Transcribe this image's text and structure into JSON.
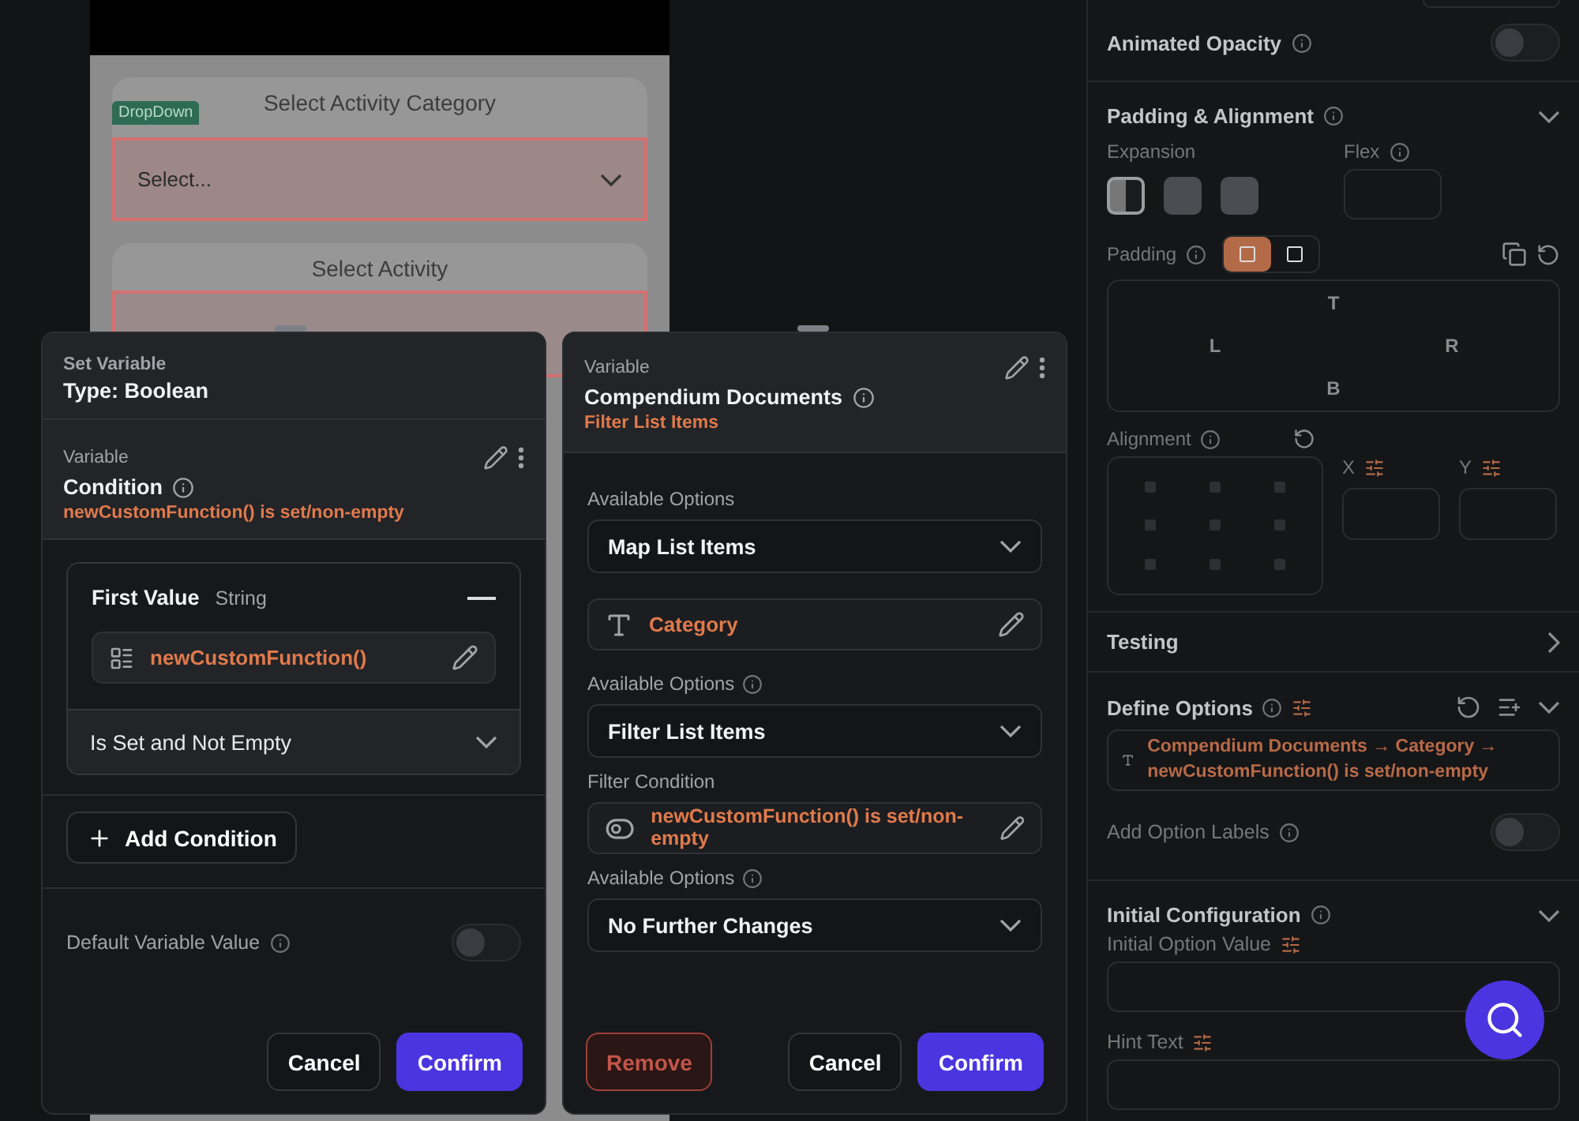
{
  "preview": {
    "cards": [
      {
        "title": "Select Activity Category",
        "tag": "DropDown",
        "value": "Select..."
      },
      {
        "title": "Select Activity"
      }
    ]
  },
  "set_variable_dialog": {
    "heading": "Set Variable",
    "type": "Type: Boolean",
    "variable_label": "Variable",
    "variable_name": "Condition",
    "variable_value": "newCustomFunction() is set/non-empty",
    "condition": {
      "label": "First Value",
      "value_type": "String",
      "function": "newCustomFunction()",
      "operator": "Is Set and Not Empty"
    },
    "add_condition": "Add Condition",
    "default_label": "Default Variable Value",
    "default_on": false,
    "buttons": [
      "Cancel",
      "Confirm"
    ]
  },
  "variable_dialog": {
    "label": "Variable",
    "name": "Compendium Documents",
    "subtitle": "Filter List Items",
    "steps": [
      {
        "kind": "select",
        "label": "Available Options",
        "info": false,
        "value": "Map List Items"
      },
      {
        "kind": "field",
        "value": "Category"
      },
      {
        "kind": "select",
        "label": "Available Options",
        "info": true,
        "value": "Filter List Items"
      },
      {
        "kind": "condition",
        "label": "Filter Condition",
        "value": "newCustomFunction() is set/non-empty"
      },
      {
        "kind": "select",
        "label": "Available Options",
        "info": true,
        "value": "No Further Changes"
      }
    ],
    "remove": "Remove",
    "buttons": [
      "Cancel",
      "Confirm"
    ]
  },
  "properties": {
    "animated_opacity": {
      "label": "Animated Opacity",
      "on": false
    },
    "padding_alignment": {
      "title": "Padding & Alignment",
      "expanded": true,
      "expansion_label": "Expansion",
      "expansion": [
        {
          "selected": true
        },
        {
          "selected": false
        },
        {
          "selected": false
        }
      ],
      "flex_label": "Flex",
      "padding_label": "Padding",
      "padding_modes": [
        {
          "selected": true
        },
        {
          "selected": false
        }
      ],
      "sides": {
        "top": "T",
        "left": "L",
        "right": "R",
        "bottom": "B"
      },
      "alignment_label": "Alignment",
      "x_label": "X",
      "y_label": "Y"
    },
    "testing": {
      "title": "Testing",
      "expanded": false
    },
    "define_options": {
      "title": "Define Options",
      "expanded": true,
      "value": "Compendium Documents → Category → newCustomFunction() is set/non-empty",
      "labels_label": "Add Option Labels",
      "labels_on": false
    },
    "initial_configuration": {
      "title": "Initial Configuration",
      "expanded": true,
      "option_label": "Initial Option Value",
      "hint_label": "Hint Text"
    }
  }
}
